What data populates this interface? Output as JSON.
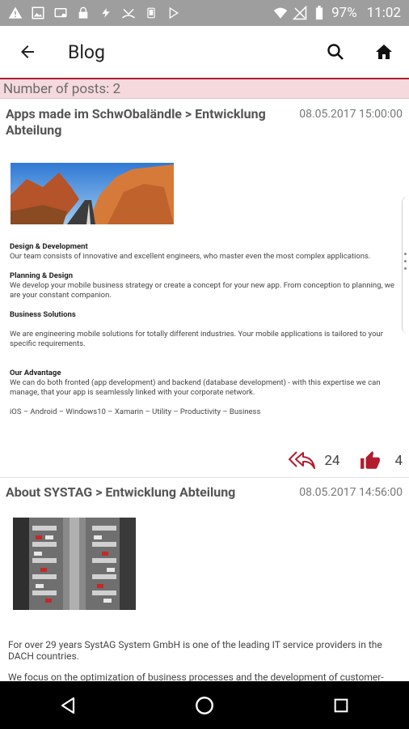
{
  "status_bar": {
    "battery_percent": "97%",
    "time": "11:02"
  },
  "app_bar": {
    "title": "Blog"
  },
  "post_count": "Number of posts: 2",
  "posts": [
    {
      "title": "Apps made im SchwObaländle > Entwicklung Abteilung",
      "date": "08.05.2017 15:00:00",
      "sections": [
        {
          "heading": "Design & Development",
          "text": "Our team consists of innovative and excellent engineers, who master even the most complex applications."
        },
        {
          "heading": "Planning & Design",
          "text": "We develop your mobile business strategy or create a concept for your new app. From conception to planning, we are your constant companion."
        },
        {
          "heading": "Business Solutions",
          "text": "We are engineering mobile solutions for totally different industries. Your mobile applications is tailored to your specific requirements."
        },
        {
          "heading": "Our Advantage",
          "text": "We can do both fronted (app development) and backend (database development) - with this expertise we can manage, that your app is seamlessly linked with your corporate network."
        }
      ],
      "tags": "iOS – Android – Windows10 – Xamarin – Utility – Productivity – Business",
      "shares": "24",
      "likes": "4"
    },
    {
      "title": "About SYSTAG > Entwicklung Abteilung",
      "date": "08.05.2017 14:56:00",
      "paragraphs": [
        "For over 29 years SystAG System GmbH is one of the leading IT service providers in the DACH countries.",
        "We focus on the optimization of business processes and the development of customer-oriented, innovative new concepts and services. Our competences are the areas of Enterprise Mobility, Security, Automation Infrastructure and Network Services."
      ]
    }
  ],
  "colors": {
    "accent": "#b01c2e",
    "count_bar": "#f5d9dc",
    "status_bar": "#9e9e9e"
  }
}
